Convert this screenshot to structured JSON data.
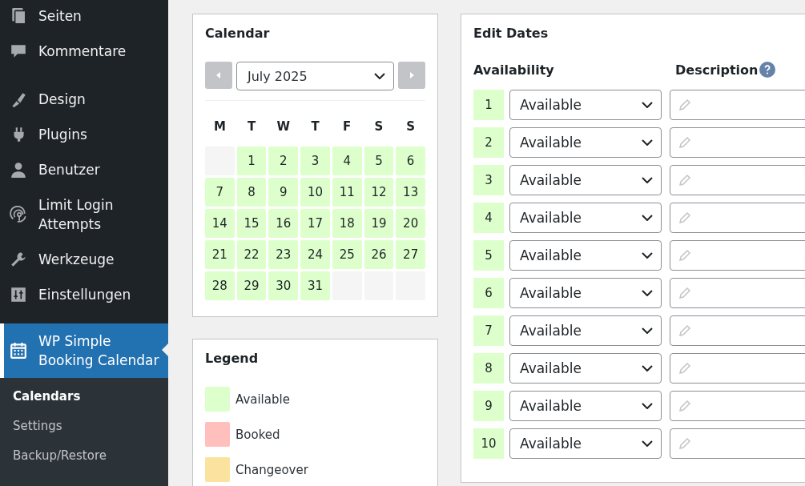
{
  "sidebar": {
    "items": [
      {
        "label": "Seiten",
        "selected": false
      },
      {
        "label": "Kommentare",
        "selected": false
      },
      {
        "label": "Design",
        "selected": false
      },
      {
        "label": "Plugins",
        "selected": false
      },
      {
        "label": "Benutzer",
        "selected": false
      },
      {
        "label": "Limit Login Attempts",
        "selected": false
      },
      {
        "label": "Werkzeuge",
        "selected": false
      },
      {
        "label": "Einstellungen",
        "selected": false
      },
      {
        "label": "WP Simple Booking Calendar",
        "selected": true
      }
    ],
    "submenu": [
      {
        "label": "Calendars",
        "selected": true
      },
      {
        "label": "Settings",
        "selected": false
      },
      {
        "label": "Backup/Restore",
        "selected": false
      }
    ]
  },
  "calendar": {
    "title": "Calendar",
    "month": "July 2025",
    "weekdays": [
      "M",
      "T",
      "W",
      "T",
      "F",
      "S",
      "S"
    ],
    "weeks": [
      [
        {
          "kind": "blank"
        },
        {
          "kind": "day",
          "day": "1",
          "color": "#ddffcc"
        },
        {
          "kind": "day",
          "day": "2",
          "color": "#ddffcc"
        },
        {
          "kind": "day",
          "day": "3",
          "color": "#ddffcc"
        },
        {
          "kind": "day",
          "day": "4",
          "color": "#ddffcc"
        },
        {
          "kind": "day",
          "day": "5",
          "color": "#ddffcc"
        },
        {
          "kind": "day",
          "day": "6",
          "color": "#ddffcc"
        }
      ],
      [
        {
          "kind": "day",
          "day": "7",
          "color": "#ddffcc"
        },
        {
          "kind": "day",
          "day": "8",
          "color": "#ddffcc"
        },
        {
          "kind": "day",
          "day": "9",
          "color": "#ddffcc"
        },
        {
          "kind": "day",
          "day": "10",
          "color": "#ddffcc"
        },
        {
          "kind": "day",
          "day": "11",
          "color": "#ddffcc"
        },
        {
          "kind": "day",
          "day": "12",
          "color": "#ddffcc"
        },
        {
          "kind": "day",
          "day": "13",
          "color": "#ddffcc"
        }
      ],
      [
        {
          "kind": "day",
          "day": "14",
          "color": "#ddffcc"
        },
        {
          "kind": "day",
          "day": "15",
          "color": "#ddffcc"
        },
        {
          "kind": "day",
          "day": "16",
          "color": "#ddffcc"
        },
        {
          "kind": "day",
          "day": "17",
          "color": "#ddffcc"
        },
        {
          "kind": "day",
          "day": "18",
          "color": "#ddffcc"
        },
        {
          "kind": "day",
          "day": "19",
          "color": "#ddffcc"
        },
        {
          "kind": "day",
          "day": "20",
          "color": "#ddffcc"
        }
      ],
      [
        {
          "kind": "day",
          "day": "21",
          "color": "#ddffcc"
        },
        {
          "kind": "day",
          "day": "22",
          "color": "#ddffcc"
        },
        {
          "kind": "day",
          "day": "23",
          "color": "#ddffcc"
        },
        {
          "kind": "day",
          "day": "24",
          "color": "#ddffcc"
        },
        {
          "kind": "day",
          "day": "25",
          "color": "#ddffcc"
        },
        {
          "kind": "day",
          "day": "26",
          "color": "#ddffcc"
        },
        {
          "kind": "day",
          "day": "27",
          "color": "#ddffcc"
        }
      ],
      [
        {
          "kind": "day",
          "day": "28",
          "color": "#ddffcc"
        },
        {
          "kind": "day",
          "day": "29",
          "color": "#ddffcc"
        },
        {
          "kind": "day",
          "day": "30",
          "color": "#ddffcc"
        },
        {
          "kind": "day",
          "day": "31",
          "color": "#ddffcc"
        },
        {
          "kind": "blank"
        },
        {
          "kind": "blank"
        },
        {
          "kind": "blank"
        }
      ]
    ]
  },
  "legend": {
    "title": "Legend",
    "items": [
      {
        "label": "Available",
        "color": "#ddffcc"
      },
      {
        "label": "Booked",
        "color": "#ffc0bd"
      },
      {
        "label": "Changeover",
        "color": "#fce29f"
      }
    ]
  },
  "edit_dates": {
    "title": "Edit Dates",
    "columns": [
      "Availability",
      "Description"
    ],
    "rows": [
      {
        "day": "1",
        "color": "#ddffcc",
        "availability": "Available"
      },
      {
        "day": "2",
        "color": "#ddffcc",
        "availability": "Available"
      },
      {
        "day": "3",
        "color": "#ddffcc",
        "availability": "Available"
      },
      {
        "day": "4",
        "color": "#ddffcc",
        "availability": "Available"
      },
      {
        "day": "5",
        "color": "#ddffcc",
        "availability": "Available"
      },
      {
        "day": "6",
        "color": "#ddffcc",
        "availability": "Available"
      },
      {
        "day": "7",
        "color": "#ddffcc",
        "availability": "Available"
      },
      {
        "day": "8",
        "color": "#ddffcc",
        "availability": "Available"
      },
      {
        "day": "9",
        "color": "#ddffcc",
        "availability": "Available"
      },
      {
        "day": "10",
        "color": "#ddffcc",
        "availability": "Available"
      }
    ]
  }
}
